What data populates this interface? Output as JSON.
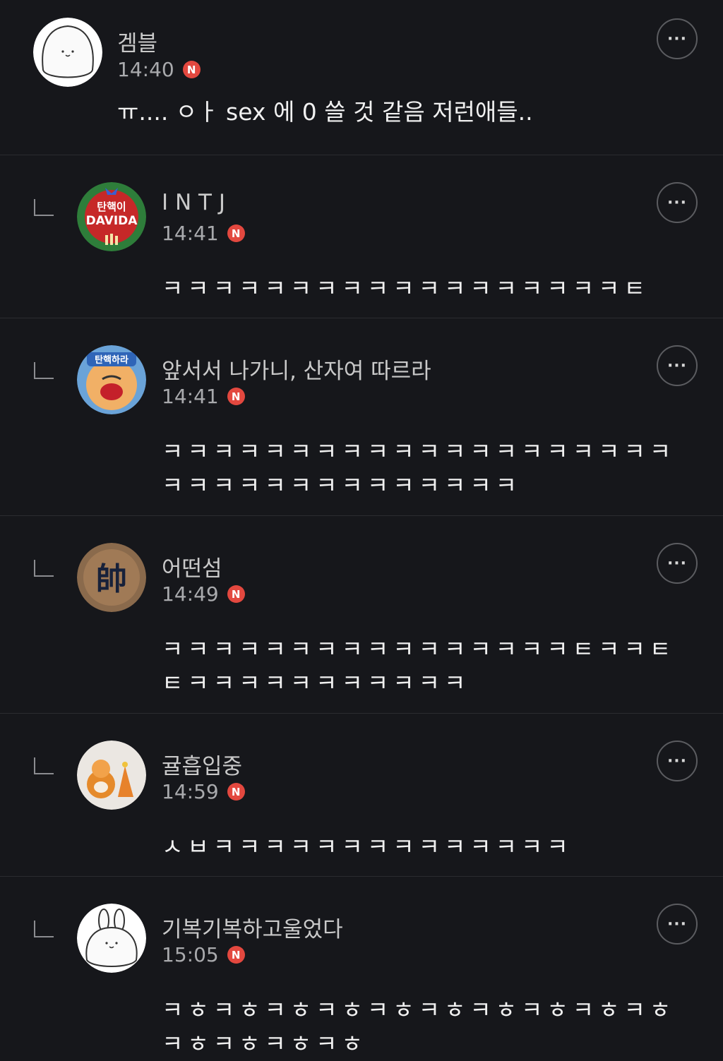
{
  "comments": [
    {
      "name": "겜블",
      "time": "14:40",
      "badge": "N",
      "text": "ㅠ.... ㅇㅏ sex 에 0 쓸 것 같음 저런애들..",
      "more": "···"
    },
    {
      "name": "I N T J",
      "time": "14:41",
      "badge": "N",
      "text": "ㅋㅋㅋㅋㅋㅋㅋㅋㅋㅋㅋㅋㅋㅋㅋㅋㅋㅋㅌ",
      "more": "···",
      "avatar_text": [
        "탄핵이",
        "DAVIDA"
      ]
    },
    {
      "name": "앞서서 나가니, 산자여 따르라",
      "time": "14:41",
      "badge": "N",
      "text": "ㅋㅋㅋㅋㅋㅋㅋㅋㅋㅋㅋㅋㅋㅋㅋㅋㅋㅋㅋㅋㅋㅋㅋㅋㅋㅋㅋㅋㅋㅋㅋㅋㅋㅋ",
      "more": "···",
      "avatar_text": [
        "탄핵하라"
      ]
    },
    {
      "name": "어떤섬",
      "time": "14:49",
      "badge": "N",
      "text": "ㅋㅋㅋㅋㅋㅋㅋㅋㅋㅋㅋㅋㅋㅋㅋㅋㅌㅋㅋㅌㅌㅋㅋㅋㅋㅋㅋㅋㅋㅋㅋㅋ",
      "more": "···",
      "avatar_text": [
        "帥"
      ]
    },
    {
      "name": "귤흡입중",
      "time": "14:59",
      "badge": "N",
      "text": "ㅅㅂㅋㅋㅋㅋㅋㅋㅋㅋㅋㅋㅋㅋㅋㅋ",
      "more": "···"
    },
    {
      "name": "기복기복하고울었다",
      "time": "15:05",
      "badge": "N",
      "text": "ㅋㅎㅋㅎㅋㅎㅋㅎㅋㅎㅋㅎㅋㅎㅋㅎㅋㅎㅋㅎㅋㅎㅋㅎㅋㅎㅋㅎ",
      "more": "···"
    }
  ],
  "colors": {
    "background": "#16171b",
    "badge": "#e3483f",
    "divider": "#2b2c30"
  }
}
